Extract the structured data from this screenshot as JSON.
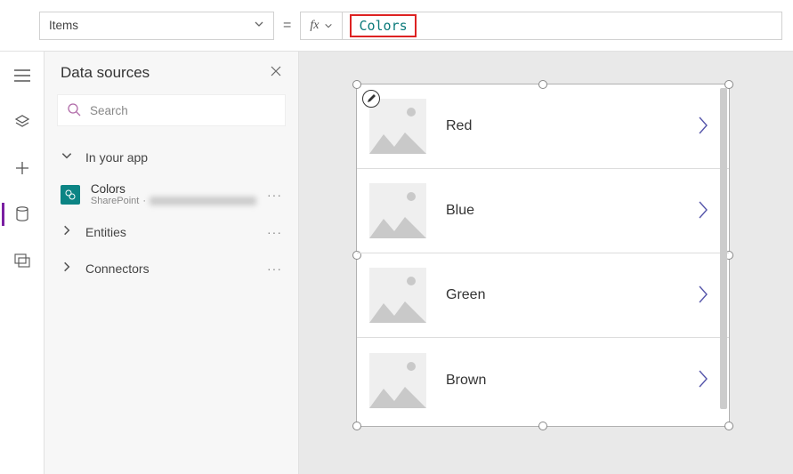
{
  "topbar": {
    "property": "Items",
    "equals": "=",
    "fx_label": "fx",
    "formula": "Colors"
  },
  "panel": {
    "title": "Data sources",
    "search_placeholder": "Search",
    "sections": {
      "in_your_app": "In your app",
      "entities": "Entities",
      "connectors": "Connectors"
    },
    "source": {
      "name": "Colors",
      "provider": "SharePoint"
    }
  },
  "gallery": {
    "items": [
      {
        "title": "Red"
      },
      {
        "title": "Blue"
      },
      {
        "title": "Green"
      },
      {
        "title": "Brown"
      }
    ]
  }
}
